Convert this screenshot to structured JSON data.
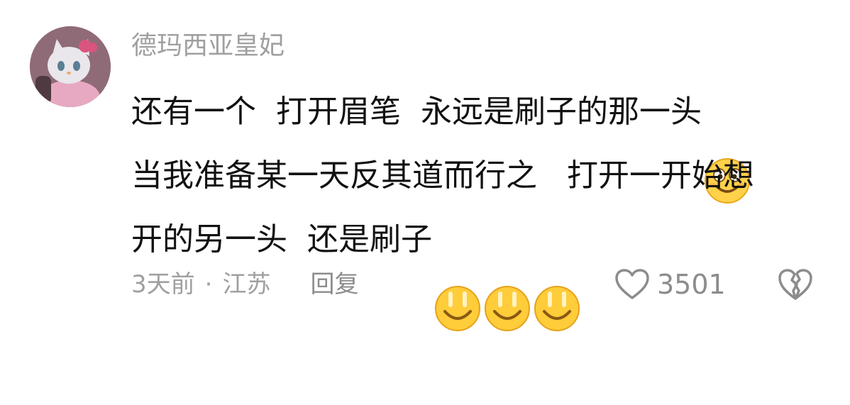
{
  "comment": {
    "username": "德玛西亚皇妃",
    "lines": [
      {
        "text": "还有一个  打开眉笔  永远是刷子的那一头",
        "emojis": [
          "smile-emoji"
        ]
      },
      {
        "text": "当我准备某一天反其道而行之   打开一开始想",
        "emojis": []
      },
      {
        "text": "开的另一头  还是刷子",
        "emojis": [
          "grin-emoji",
          "grin-emoji",
          "grin-emoji"
        ]
      }
    ],
    "time": "3天前",
    "separator": "·",
    "location": "江苏",
    "reply_label": "回复",
    "like_count": "3501"
  },
  "colors": {
    "meta_text": "#a0a0a0",
    "body_text": "#111111",
    "emoji_yellow": "#ffcc3a"
  },
  "icons": {
    "like": "heart-outline-icon",
    "dislike": "broken-heart-icon"
  }
}
